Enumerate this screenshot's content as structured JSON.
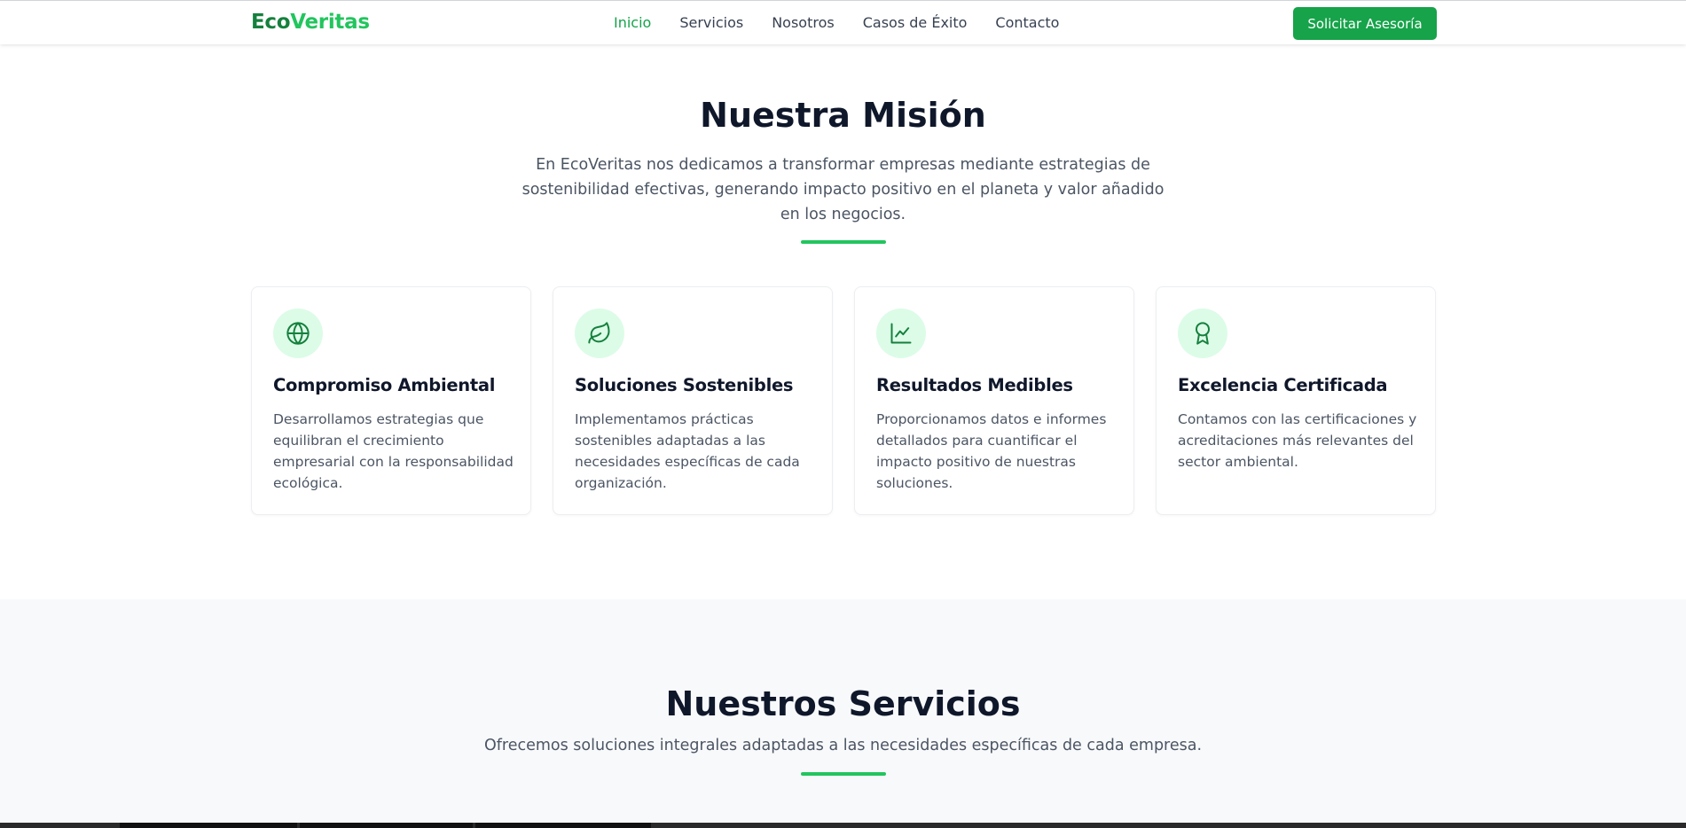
{
  "brand": {
    "part1": "Eco",
    "part2": "Veritas"
  },
  "nav": {
    "links": [
      "Inicio",
      "Servicios",
      "Nosotros",
      "Casos de Éxito",
      "Contacto"
    ],
    "active": "Inicio",
    "cta": "Solicitar Asesoría"
  },
  "mission": {
    "title": "Nuestra Misión",
    "description": "En EcoVeritas nos dedicamos a transformar empresas mediante estrategias de sostenibilidad efectivas, generando impacto positivo en el planeta y valor añadido en los negocios.",
    "cards": [
      {
        "icon": "globe-icon",
        "title": "Compromiso Ambiental",
        "text": "Desarrollamos estrategias que equilibran el crecimiento empresarial con la responsabilidad ecológica."
      },
      {
        "icon": "leaf-icon",
        "title": "Soluciones Sostenibles",
        "text": "Implementamos prácticas sostenibles adaptadas a las necesidades específicas de cada organización."
      },
      {
        "icon": "chart-line-icon",
        "title": "Resultados Medibles",
        "text": "Proporcionamos datos e informes detallados para cuantificar el impacto positivo de nuestras soluciones."
      },
      {
        "icon": "award-icon",
        "title": "Excelencia Certificada",
        "text": "Contamos con las certificaciones y acreditaciones más relevantes del sector ambiental."
      }
    ]
  },
  "services": {
    "title": "Nuestros Servicios",
    "description": "Ofrecemos soluciones integrales adaptadas a las necesidades específicas de cada empresa."
  },
  "colors": {
    "brand_dark": "#15803d",
    "brand_light": "#22c55e",
    "button": "#16a34a",
    "icon_bg": "#dcfce7",
    "section_bg": "#f8f9fb"
  }
}
